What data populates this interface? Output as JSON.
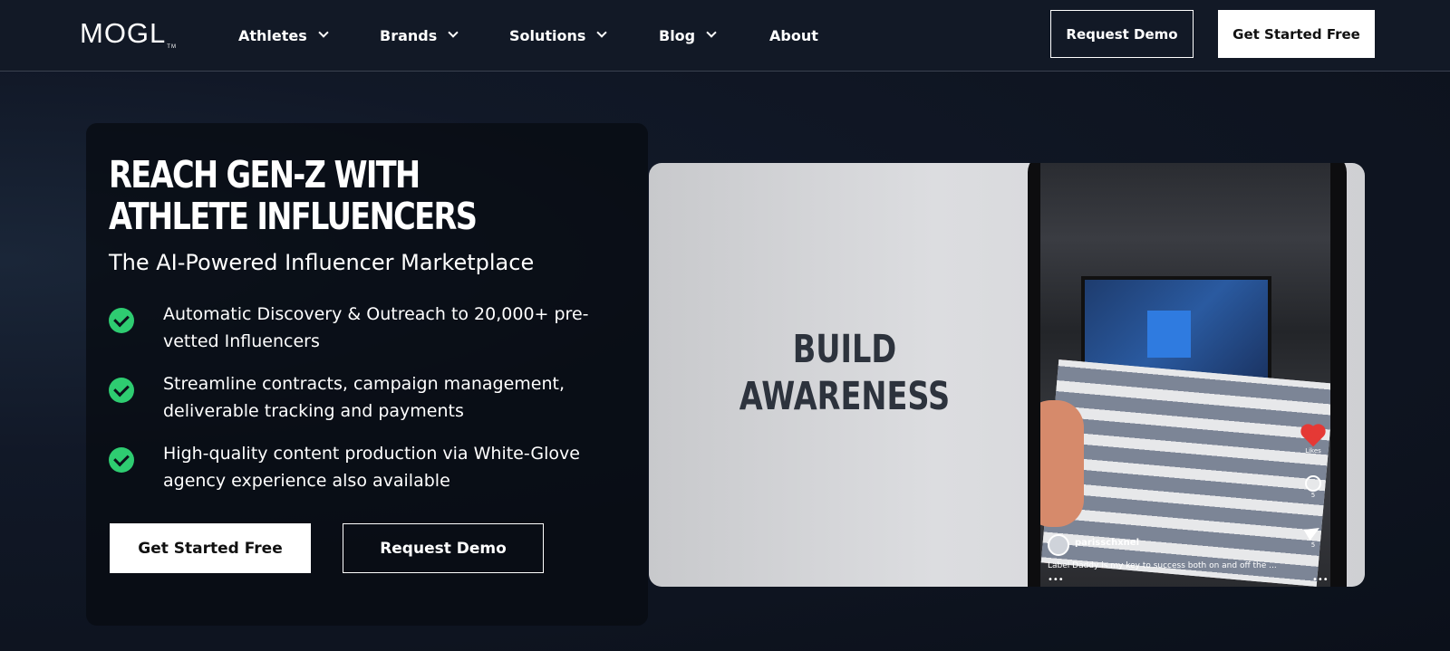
{
  "nav": {
    "logo": "MOGL",
    "logo_mark": "TM",
    "items": [
      {
        "label": "Athletes",
        "has_dropdown": true
      },
      {
        "label": "Brands",
        "has_dropdown": true
      },
      {
        "label": "Solutions",
        "has_dropdown": true
      },
      {
        "label": "Blog",
        "has_dropdown": true
      },
      {
        "label": "About",
        "has_dropdown": false
      }
    ],
    "request_demo": "Request Demo",
    "get_started": "Get Started Free"
  },
  "hero": {
    "headline": "REACH GEN-Z WITH ATHLETE INFLUENCERS",
    "headline_line1": "REACH GEN-Z WITH",
    "headline_line2": "ATHLETE INFLUENCERS",
    "subhead": "The AI-Powered Influencer Marketplace",
    "features": [
      "Automatic Discovery & Outreach to 20,000+ pre-vetted Influencers",
      "Streamline contracts, campaign management, deliverable tracking and payments",
      "High-quality content production via White-Glove agency experience also available"
    ],
    "cta_primary": "Get Started Free",
    "cta_secondary": "Request Demo"
  },
  "video": {
    "overlay_line1": "BUILD",
    "overlay_line2": "AWARENESS",
    "likes_label": "Likes",
    "comments_count": "5",
    "shares_count": "5",
    "handle": "parisschxnel",
    "caption": "Label Daddy is my key to success both on and off the ...",
    "more_dots": "•••",
    "left_dots": "•••"
  },
  "colors": {
    "check": "#2ecc71",
    "background": "#0e1420",
    "nav": "#121926"
  }
}
